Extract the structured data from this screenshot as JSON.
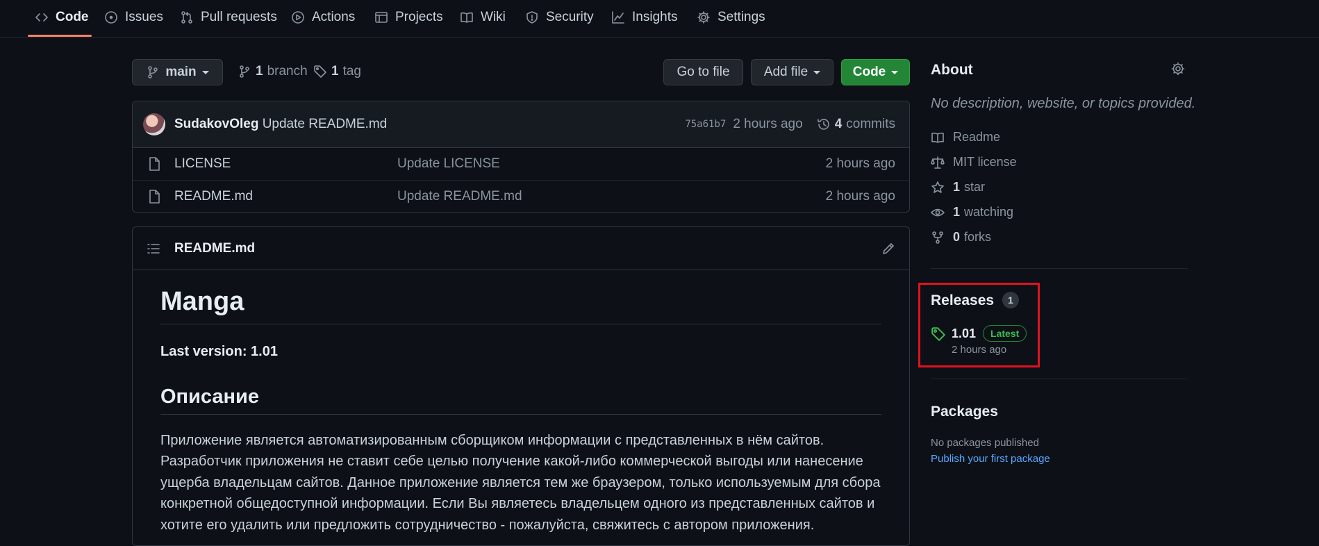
{
  "nav": {
    "tabs": [
      {
        "label": "Code",
        "icon": "code-icon"
      },
      {
        "label": "Issues",
        "icon": "issue-icon"
      },
      {
        "label": "Pull requests",
        "icon": "pull-request-icon"
      },
      {
        "label": "Actions",
        "icon": "play-icon"
      },
      {
        "label": "Projects",
        "icon": "table-icon"
      },
      {
        "label": "Wiki",
        "icon": "book-icon"
      },
      {
        "label": "Security",
        "icon": "shield-icon"
      },
      {
        "label": "Insights",
        "icon": "graph-icon"
      },
      {
        "label": "Settings",
        "icon": "gear-icon"
      }
    ],
    "active_tab": "Code"
  },
  "toolbar": {
    "branch": "main",
    "branch_count": "1",
    "branch_label": "branch",
    "tag_count": "1",
    "tag_label": "tag",
    "go_to_file": "Go to file",
    "add_file": "Add file",
    "code": "Code"
  },
  "commit": {
    "author": "SudakovOleg",
    "message": "Update README.md",
    "hash": "75a61b7",
    "time": "2 hours ago",
    "count": "4",
    "count_label": "commits"
  },
  "files": [
    {
      "name": "LICENSE",
      "message": "Update LICENSE",
      "time": "2 hours ago"
    },
    {
      "name": "README.md",
      "message": "Update README.md",
      "time": "2 hours ago"
    }
  ],
  "readme": {
    "filename": "README.md",
    "title": "Manga",
    "last_version": "Last version: 1.01",
    "section_title": "Описание",
    "paragraph": "Приложение является автоматизированным сборщиком информации с представленных в нём сайтов. Разработчик приложения не ставит себе целью получение какой-либо коммерческой выгоды или нанесение ущерба владельцам сайтов. Данное приложение является тем же браузером, только используемым для сбора конкретной общедоступной информации. Если Вы являетесь владельцем одного из представленных сайтов и хотите его удалить или предложить сотрудничество - пожалуйста, свяжитесь с автором приложения."
  },
  "about": {
    "title": "About",
    "description": "No description, website, or topics provided.",
    "readme": "Readme",
    "license": "MIT license",
    "stars_count": "1",
    "stars_label": "star",
    "watching_count": "1",
    "watching_label": "watching",
    "forks_count": "0",
    "forks_label": "forks"
  },
  "releases": {
    "title": "Releases",
    "count": "1",
    "latest_version": "1.01",
    "latest_badge": "Latest",
    "latest_time": "2 hours ago"
  },
  "packages": {
    "title": "Packages",
    "none_text": "No packages published",
    "publish_link": "Publish your first package"
  },
  "colors": {
    "background": "#0d1117",
    "accent_green": "#238636",
    "link_blue": "#58a6ff",
    "active_tab_underline": "#f78166",
    "highlight_box": "#e0121e"
  }
}
